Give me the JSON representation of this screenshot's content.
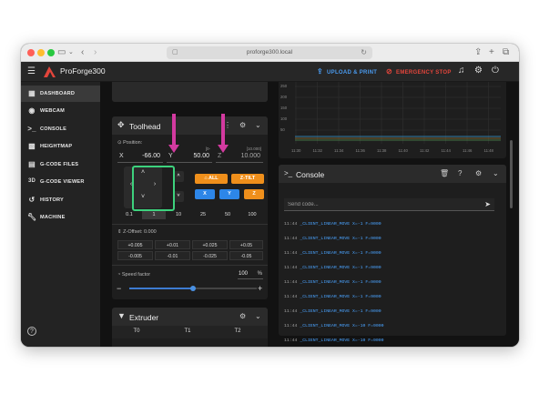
{
  "browser": {
    "url": "proforge300.local"
  },
  "app": {
    "title": "ProForge300",
    "upload_label": "UPLOAD & PRINT",
    "estop_label": "EMERGENCY STOP",
    "colors": {
      "accent_blue": "#2d86e8",
      "estop_red": "#e3453b",
      "orange": "#ef8f1b",
      "highlight_green": "#3dd27d",
      "annotation_pink": "#d33aa0"
    }
  },
  "sidebar": {
    "items": [
      {
        "label": "DASHBOARD",
        "icon": "dashboard-icon",
        "active": true
      },
      {
        "label": "WEBCAM",
        "icon": "webcam-icon"
      },
      {
        "label": "CONSOLE",
        "icon": "console-icon"
      },
      {
        "label": "HEIGHTMAP",
        "icon": "heightmap-icon"
      },
      {
        "label": "G-CODE FILES",
        "icon": "file-icon"
      },
      {
        "label": "G-CODE VIEWER",
        "icon": "3d-icon"
      },
      {
        "label": "HISTORY",
        "icon": "history-icon"
      },
      {
        "label": "MACHINE",
        "icon": "wrench-icon"
      }
    ]
  },
  "toolhead": {
    "title": "Toolhead",
    "position_label": "Position: ",
    "x_label": "X",
    "x_value": "-66.00",
    "y_label": "Y",
    "y_value": "50.00",
    "y_hint": "[0-",
    "z_label": "Z",
    "z_value": "10.000",
    "z_hint": "[10.000]",
    "home_all": "ALL",
    "z_tilt": "Z-TILT",
    "home_x": "X",
    "home_y": "Y",
    "home_z": "Z",
    "step_sizes": [
      "0.1",
      "1",
      "10",
      "25",
      "50",
      "100"
    ],
    "z_offset_label": "Z-Offset: 0.000",
    "z_offset_plus": [
      "+0.005",
      "+0.01",
      "+0.025",
      "+0.05"
    ],
    "z_offset_minus": [
      "-0.005",
      "-0.01",
      "-0.025",
      "-0.05"
    ],
    "speed_label": "Speed factor",
    "speed_value": "100",
    "speed_unit": "%",
    "speed_fraction": 0.5
  },
  "extruder": {
    "title": "Extruder",
    "tools": [
      "T0",
      "T1",
      "T2"
    ]
  },
  "temperature_chart": {
    "y_ticks": [
      "250",
      "200",
      "150",
      "100",
      "50"
    ],
    "x_ticks": [
      "11:30",
      "11:32",
      "11:34",
      "11:36",
      "11:38",
      "11:40",
      "11:42",
      "11:44",
      "11:46",
      "11:48"
    ]
  },
  "console": {
    "title": "Console",
    "placeholder": "Send code...",
    "lines": [
      {
        "time": "11:44",
        "text": "_CLIENT_LINEAR_MOVE X=-1 F=9000"
      },
      {
        "time": "11:44",
        "text": "_CLIENT_LINEAR_MOVE X=-1 F=9000"
      },
      {
        "time": "11:44",
        "text": "_CLIENT_LINEAR_MOVE X=-1 F=9000"
      },
      {
        "time": "11:44",
        "text": "_CLIENT_LINEAR_MOVE X=-1 F=9000"
      },
      {
        "time": "11:44",
        "text": "_CLIENT_LINEAR_MOVE X=-1 F=9000"
      },
      {
        "time": "11:44",
        "text": "_CLIENT_LINEAR_MOVE X=-1 F=9000"
      },
      {
        "time": "11:44",
        "text": "_CLIENT_LINEAR_MOVE X=-1 F=9000"
      },
      {
        "time": "11:44",
        "text": "_CLIENT_LINEAR_MOVE X=-10 F=9000"
      },
      {
        "time": "11:44",
        "text": "_CLIENT_LINEAR_MOVE X=-10 F=9000"
      }
    ]
  }
}
